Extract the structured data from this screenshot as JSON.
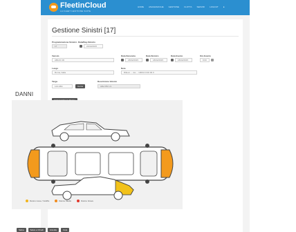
{
  "app": {
    "name": "FleetinCloud",
    "tagline": "LA FLEET GESTIONE SUITE"
  },
  "nav": {
    "items": [
      "HOME",
      "ANAGRAFICHE",
      "GESTIONE",
      "FLOTTA",
      "SERVIZI",
      "LOGOUT"
    ],
    "user_icon": "person-icon"
  },
  "page": {
    "title": "Gestione Sinistri [17]"
  },
  "form": {
    "programmazione_label": "Programmazione Sinistro",
    "programmazione_value": "17",
    "data_reg_label": "Data/Reg.Sinistro",
    "data_reg_value": "24/02/2015",
    "veicolo_label": "Veicolo",
    "veicolo_value": "AB123 CD",
    "data_denuncia_label": "Data Denuncia",
    "data_denuncia_value": "18/02/2015",
    "data_sinistro_label": "Data Sinistro",
    "data_sinistro_value": "18/02/2015",
    "data_evento_label": "Data Evento",
    "data_evento_value": "18/02/2015",
    "ora_label": "Ora Evento",
    "ora_value": "9:00",
    "luogo_label": "Luogo",
    "luogo_value": "Roma, Italia",
    "note_label": "Note",
    "note_value": "Rilievo ... via ... 100/10 0:00 00 0",
    "targa_label": "Targa",
    "targa_value": "123 ABC",
    "targa_button": "Cerca",
    "desc_label": "Descrizione Veicolo",
    "desc_value": "Alfa 159 1.9",
    "add_button": "Aggiungi Nuovo Danno"
  },
  "danni": {
    "heading": "DANNI",
    "legend": [
      {
        "label": "Danno Lieve / Graffio",
        "color": "#f2b41a"
      },
      {
        "label": "Danno Medio",
        "color": "#f08a1c"
      },
      {
        "label": "Danno Grave",
        "color": "#e0362a"
      }
    ],
    "colors": {
      "orange": "#f39a1d",
      "yellow": "#f2c21a",
      "car_fill": "#ffffff",
      "car_line": "#444444"
    }
  },
  "footer": {
    "buttons": [
      "Salva",
      "Salva e Chiudi",
      "Annulla",
      "Invia"
    ]
  }
}
